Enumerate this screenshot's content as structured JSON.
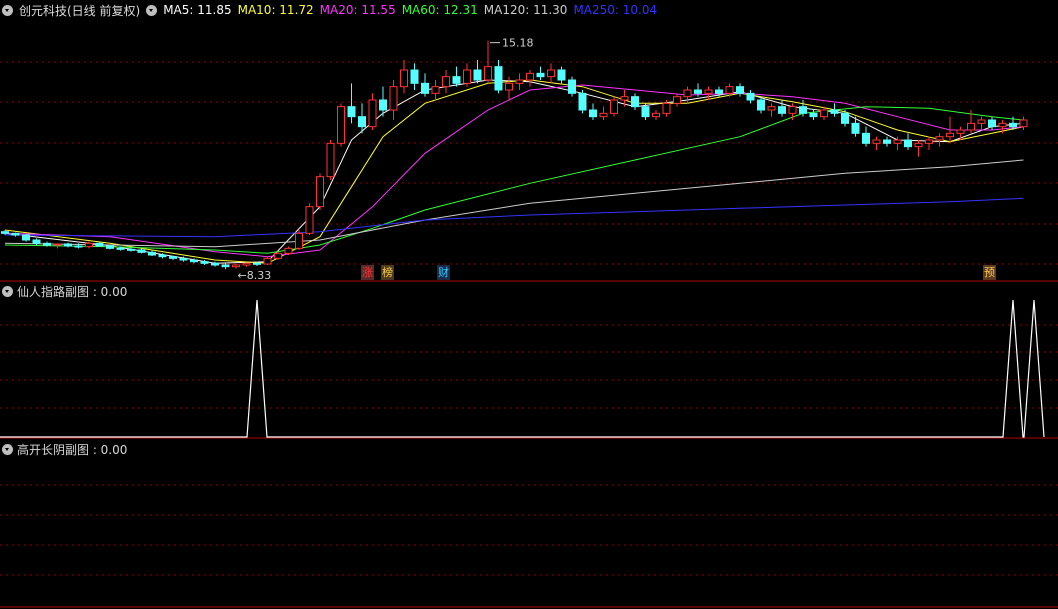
{
  "title": "创元科技(日线 前复权)",
  "ma_legend": [
    {
      "label": "MA5: 11.85",
      "color": "#ffffff"
    },
    {
      "label": "MA10: 11.72",
      "color": "#ffff33"
    },
    {
      "label": "MA20: 11.55",
      "color": "#ff33ff"
    },
    {
      "label": "MA60: 12.31",
      "color": "#33ff33"
    },
    {
      "label": "MA120: 11.30",
      "color": "#cccccc"
    },
    {
      "label": "MA250: 10.04",
      "color": "#3333ff"
    }
  ],
  "annotations": {
    "high_label": "15.18",
    "low_label": "8.33"
  },
  "event_markers": [
    {
      "text": "涨",
      "color": "#ff3333",
      "bg": "#5a2a2a"
    },
    {
      "text": "榜",
      "color": "#ffcc44",
      "bg": "#4a3a20"
    },
    {
      "text": "财",
      "color": "#33ccff",
      "bg": "#1a2a4a"
    },
    {
      "text": "预",
      "color": "#ffcc44",
      "bg": "#5a3a20"
    }
  ],
  "panels": [
    {
      "title": "仙人指路副图 : 0.00"
    },
    {
      "title": "高开长阴副图 : 0.00"
    }
  ],
  "colors": {
    "up": "#ff3333",
    "down": "#54ffff",
    "grid": "#8b0000",
    "divider": "#b00000"
  },
  "chart_data": {
    "type": "candlestick",
    "price_range": [
      8.0,
      15.8
    ],
    "ohlc": [
      [
        9.45,
        9.5,
        9.35,
        9.4
      ],
      [
        9.4,
        9.42,
        9.3,
        9.35
      ],
      [
        9.35,
        9.38,
        9.15,
        9.2
      ],
      [
        9.2,
        9.25,
        9.05,
        9.1
      ],
      [
        9.1,
        9.15,
        9.0,
        9.05
      ],
      [
        9.05,
        9.1,
        8.95,
        9.08
      ],
      [
        9.08,
        9.12,
        8.98,
        9.02
      ],
      [
        9.02,
        9.1,
        8.95,
        9.0
      ],
      [
        9.0,
        9.15,
        8.95,
        9.1
      ],
      [
        9.1,
        9.12,
        9.0,
        9.02
      ],
      [
        9.02,
        9.05,
        8.92,
        8.95
      ],
      [
        8.95,
        9.0,
        8.88,
        8.92
      ],
      [
        8.92,
        8.98,
        8.85,
        8.9
      ],
      [
        8.9,
        8.95,
        8.8,
        8.83
      ],
      [
        8.83,
        8.88,
        8.72,
        8.75
      ],
      [
        8.75,
        8.8,
        8.65,
        8.7
      ],
      [
        8.7,
        8.73,
        8.6,
        8.65
      ],
      [
        8.65,
        8.7,
        8.55,
        8.6
      ],
      [
        8.6,
        8.65,
        8.5,
        8.55
      ],
      [
        8.55,
        8.6,
        8.45,
        8.5
      ],
      [
        8.5,
        8.55,
        8.4,
        8.45
      ],
      [
        8.45,
        8.5,
        8.33,
        8.4
      ],
      [
        8.4,
        8.48,
        8.35,
        8.45
      ],
      [
        8.45,
        8.52,
        8.4,
        8.5
      ],
      [
        8.5,
        8.55,
        8.42,
        8.48
      ],
      [
        8.48,
        8.7,
        8.45,
        8.65
      ],
      [
        8.65,
        8.85,
        8.6,
        8.8
      ],
      [
        8.8,
        9.0,
        8.75,
        8.95
      ],
      [
        8.95,
        9.5,
        8.9,
        9.4
      ],
      [
        9.4,
        10.3,
        9.35,
        10.2
      ],
      [
        10.2,
        11.2,
        10.1,
        11.1
      ],
      [
        11.1,
        12.2,
        11.0,
        12.1
      ],
      [
        12.1,
        13.3,
        12.0,
        13.2
      ],
      [
        13.2,
        13.9,
        12.7,
        12.9
      ],
      [
        12.9,
        13.3,
        12.4,
        12.6
      ],
      [
        12.6,
        13.6,
        12.5,
        13.4
      ],
      [
        13.4,
        13.8,
        12.9,
        13.1
      ],
      [
        13.1,
        14.0,
        12.8,
        13.8
      ],
      [
        13.8,
        14.6,
        13.6,
        14.3
      ],
      [
        14.3,
        14.5,
        13.7,
        13.9
      ],
      [
        13.9,
        14.2,
        13.5,
        13.6
      ],
      [
        13.6,
        14.0,
        13.4,
        13.8
      ],
      [
        13.8,
        14.3,
        13.6,
        14.1
      ],
      [
        14.1,
        14.4,
        13.8,
        13.9
      ],
      [
        13.9,
        14.5,
        13.8,
        14.3
      ],
      [
        14.3,
        14.6,
        13.9,
        14.0
      ],
      [
        14.0,
        15.18,
        13.9,
        14.4
      ],
      [
        14.4,
        14.6,
        13.6,
        13.7
      ],
      [
        13.7,
        14.1,
        13.4,
        13.9
      ],
      [
        13.9,
        14.2,
        13.7,
        14.0
      ],
      [
        14.0,
        14.3,
        13.8,
        14.2
      ],
      [
        14.2,
        14.4,
        14.0,
        14.1
      ],
      [
        14.1,
        14.5,
        13.9,
        14.3
      ],
      [
        14.3,
        14.4,
        13.9,
        14.0
      ],
      [
        14.0,
        14.1,
        13.5,
        13.6
      ],
      [
        13.6,
        13.7,
        13.0,
        13.1
      ],
      [
        13.1,
        13.3,
        12.8,
        12.9
      ],
      [
        12.9,
        13.2,
        12.8,
        13.0
      ],
      [
        13.0,
        13.5,
        12.9,
        13.4
      ],
      [
        13.4,
        13.7,
        13.2,
        13.5
      ],
      [
        13.5,
        13.6,
        13.1,
        13.2
      ],
      [
        13.2,
        13.3,
        12.8,
        12.9
      ],
      [
        12.9,
        13.1,
        12.8,
        13.0
      ],
      [
        13.0,
        13.4,
        12.9,
        13.3
      ],
      [
        13.3,
        13.6,
        13.2,
        13.5
      ],
      [
        13.5,
        13.8,
        13.3,
        13.7
      ],
      [
        13.7,
        13.9,
        13.5,
        13.6
      ],
      [
        13.6,
        13.8,
        13.4,
        13.7
      ],
      [
        13.7,
        13.8,
        13.5,
        13.6
      ],
      [
        13.6,
        13.9,
        13.5,
        13.8
      ],
      [
        13.8,
        13.9,
        13.5,
        13.6
      ],
      [
        13.6,
        13.7,
        13.3,
        13.4
      ],
      [
        13.4,
        13.5,
        13.0,
        13.1
      ],
      [
        13.1,
        13.3,
        12.9,
        13.2
      ],
      [
        13.2,
        13.4,
        12.9,
        13.0
      ],
      [
        13.0,
        13.3,
        12.8,
        13.2
      ],
      [
        13.2,
        13.4,
        12.9,
        13.0
      ],
      [
        13.0,
        13.1,
        12.8,
        12.9
      ],
      [
        12.9,
        13.2,
        12.8,
        13.1
      ],
      [
        13.1,
        13.3,
        12.9,
        13.0
      ],
      [
        13.0,
        13.1,
        12.6,
        12.7
      ],
      [
        12.7,
        12.9,
        12.3,
        12.4
      ],
      [
        12.4,
        12.6,
        12.0,
        12.1
      ],
      [
        12.1,
        12.3,
        11.9,
        12.2
      ],
      [
        12.2,
        12.3,
        12.0,
        12.1
      ],
      [
        12.1,
        12.3,
        11.9,
        12.2
      ],
      [
        12.2,
        12.4,
        11.9,
        12.0
      ],
      [
        12.0,
        12.2,
        11.7,
        12.1
      ],
      [
        12.1,
        12.3,
        11.9,
        12.2
      ],
      [
        12.2,
        12.4,
        12.0,
        12.3
      ],
      [
        12.3,
        12.9,
        12.1,
        12.4
      ],
      [
        12.4,
        12.6,
        12.2,
        12.5
      ],
      [
        12.5,
        13.1,
        12.4,
        12.7
      ],
      [
        12.7,
        12.9,
        12.5,
        12.8
      ],
      [
        12.8,
        12.9,
        12.5,
        12.6
      ],
      [
        12.6,
        12.8,
        12.4,
        12.7
      ],
      [
        12.7,
        12.9,
        12.5,
        12.6
      ],
      [
        12.6,
        12.9,
        12.5,
        12.8
      ]
    ],
    "ma_series": [
      {
        "name": "MA5",
        "color": "#ffffff",
        "points": [
          [
            0,
            9.4
          ],
          [
            10,
            9.03
          ],
          [
            20,
            8.5
          ],
          [
            25,
            8.55
          ],
          [
            30,
            10.2
          ],
          [
            33,
            12.2
          ],
          [
            36,
            13.0
          ],
          [
            40,
            13.7
          ],
          [
            46,
            14.0
          ],
          [
            50,
            13.95
          ],
          [
            55,
            13.6
          ],
          [
            60,
            13.2
          ],
          [
            65,
            13.4
          ],
          [
            70,
            13.65
          ],
          [
            75,
            13.2
          ],
          [
            80,
            13.0
          ],
          [
            85,
            12.2
          ],
          [
            90,
            12.15
          ],
          [
            94,
            12.6
          ],
          [
            97,
            12.7
          ]
        ]
      },
      {
        "name": "MA10",
        "color": "#ffff33",
        "points": [
          [
            0,
            9.5
          ],
          [
            10,
            9.1
          ],
          [
            20,
            8.6
          ],
          [
            25,
            8.5
          ],
          [
            30,
            9.3
          ],
          [
            33,
            10.8
          ],
          [
            36,
            12.3
          ],
          [
            40,
            13.3
          ],
          [
            46,
            13.9
          ],
          [
            50,
            14.0
          ],
          [
            55,
            13.8
          ],
          [
            60,
            13.3
          ],
          [
            65,
            13.3
          ],
          [
            70,
            13.6
          ],
          [
            75,
            13.35
          ],
          [
            80,
            13.05
          ],
          [
            85,
            12.5
          ],
          [
            90,
            12.15
          ],
          [
            94,
            12.4
          ],
          [
            97,
            12.6
          ]
        ]
      },
      {
        "name": "MA20",
        "color": "#ff33ff",
        "points": [
          [
            0,
            9.4
          ],
          [
            10,
            9.3
          ],
          [
            20,
            8.85
          ],
          [
            25,
            8.7
          ],
          [
            30,
            8.9
          ],
          [
            35,
            10.2
          ],
          [
            40,
            11.8
          ],
          [
            46,
            13.1
          ],
          [
            50,
            13.7
          ],
          [
            55,
            13.85
          ],
          [
            60,
            13.7
          ],
          [
            65,
            13.55
          ],
          [
            70,
            13.6
          ],
          [
            75,
            13.5
          ],
          [
            80,
            13.3
          ],
          [
            85,
            12.9
          ],
          [
            90,
            12.5
          ],
          [
            94,
            12.5
          ],
          [
            97,
            12.6
          ]
        ]
      },
      {
        "name": "MA60",
        "color": "#33ff33",
        "points": [
          [
            0,
            9.05
          ],
          [
            10,
            9.0
          ],
          [
            20,
            8.9
          ],
          [
            25,
            8.8
          ],
          [
            30,
            9.05
          ],
          [
            35,
            9.55
          ],
          [
            40,
            10.1
          ],
          [
            50,
            10.9
          ],
          [
            60,
            11.6
          ],
          [
            70,
            12.3
          ],
          [
            76,
            13.0
          ],
          [
            82,
            13.2
          ],
          [
            88,
            13.15
          ],
          [
            94,
            12.9
          ],
          [
            97,
            12.8
          ]
        ]
      },
      {
        "name": "MA120",
        "color": "#cccccc",
        "points": [
          [
            0,
            9.1
          ],
          [
            20,
            9.0
          ],
          [
            30,
            9.2
          ],
          [
            40,
            9.8
          ],
          [
            50,
            10.3
          ],
          [
            60,
            10.6
          ],
          [
            70,
            10.9
          ],
          [
            80,
            11.2
          ],
          [
            90,
            11.4
          ],
          [
            97,
            11.6
          ]
        ]
      },
      {
        "name": "MA250",
        "color": "#3333ff",
        "points": [
          [
            0,
            9.35
          ],
          [
            20,
            9.3
          ],
          [
            30,
            9.45
          ],
          [
            40,
            9.8
          ],
          [
            50,
            9.95
          ],
          [
            60,
            10.05
          ],
          [
            70,
            10.15
          ],
          [
            80,
            10.25
          ],
          [
            90,
            10.35
          ],
          [
            97,
            10.45
          ]
        ]
      }
    ],
    "subchart1_peaks": [
      24,
      96,
      98
    ]
  }
}
